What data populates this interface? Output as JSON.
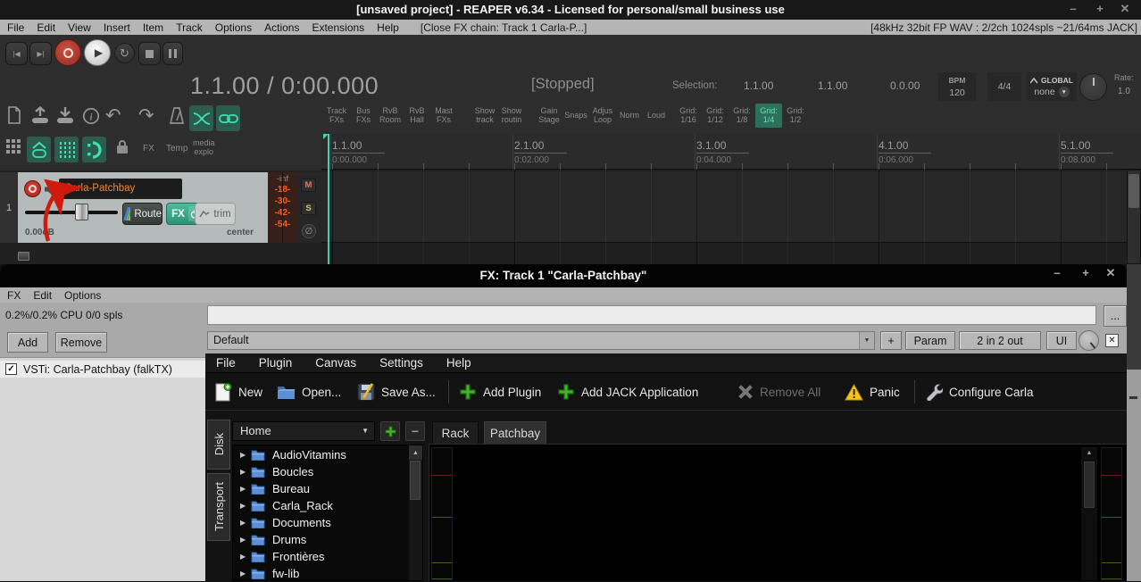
{
  "titlebar": {
    "title": "[unsaved project] - REAPER v6.34 - Licensed for personal/small business use",
    "minimize": "–",
    "maximize": "+",
    "close": "✕"
  },
  "menubar": {
    "items": [
      "File",
      "Edit",
      "View",
      "Insert",
      "Item",
      "Track",
      "Options",
      "Actions",
      "Extensions",
      "Help"
    ],
    "action_hint": "[Close FX chain: Track 1 Carla-P...]",
    "audio_status": "[48kHz 32bit FP WAV : 2/2ch 1024spls ~21/64ms JACK]"
  },
  "transport": {
    "time": "1.1.00 / 0:00.000",
    "status": "[Stopped]",
    "selection_label": "Selection:",
    "selection_start": "1.1.00",
    "selection_end": "1.1.00",
    "selection_length": "0.0.00",
    "bpm_label": "BPM",
    "bpm": "120",
    "time_signature": "4/4",
    "global_label": "GLOBAL",
    "global_value": "none",
    "rate_label": "Rate:",
    "rate": "1.0"
  },
  "toolbar_toggles": {
    "items": [
      {
        "l1": "Track",
        "l2": "FXs"
      },
      {
        "l1": "Bus",
        "l2": "FXs"
      },
      {
        "l1": "RvB",
        "l2": "Room"
      },
      {
        "l1": "RvB",
        "l2": "Hall"
      },
      {
        "l1": "Mast",
        "l2": "FXs"
      },
      {
        "l1": "Show",
        "l2": "track"
      },
      {
        "l1": "Show",
        "l2": "routin"
      },
      {
        "l1": "Gain",
        "l2": "Stage"
      },
      {
        "l1": "Snaps",
        "l2": ""
      },
      {
        "l1": "Adjus",
        "l2": "Loop"
      },
      {
        "l1": "Norm",
        "l2": ""
      },
      {
        "l1": "Loud",
        "l2": ""
      },
      {
        "l1": "Grid:",
        "l2": "1/16"
      },
      {
        "l1": "Grid:",
        "l2": "1/12"
      },
      {
        "l1": "Grid:",
        "l2": "1/8"
      },
      {
        "l1": "Grid:",
        "l2": "1/4"
      },
      {
        "l1": "Grid:",
        "l2": "1/2"
      }
    ]
  },
  "icon_labels": {
    "fx": "FX",
    "temp": "Temp",
    "media_1": "media",
    "media_2": "explo"
  },
  "track": {
    "number": "1",
    "name": "Carla-Patchbay",
    "volume": "0.00dB",
    "pan": "center",
    "route": "Route",
    "fx": "FX",
    "trim": "trim",
    "meter_top": "-inf",
    "marks": [
      "-18-",
      "-30-",
      "-42-",
      "-54-"
    ],
    "mute": "M",
    "solo": "S",
    "phase": "∅"
  },
  "ruler": {
    "majors": [
      {
        "m": "1.1.00",
        "t": "0:00.000"
      },
      {
        "m": "2.1.00",
        "t": "0:02.000"
      },
      {
        "m": "3.1.00",
        "t": "0:04.000"
      },
      {
        "m": "4.1.00",
        "t": "0:06.000"
      },
      {
        "m": "5.1.00",
        "t": "0:08.000"
      }
    ]
  },
  "fx_window": {
    "title": "FX: Track 1 \"Carla-Patchbay\"",
    "minimize": "–",
    "maximize": "+",
    "close": "✕",
    "menu": [
      "FX",
      "Edit",
      "Options"
    ],
    "cpu": "0.2%/0.2% CPU 0/0 spls",
    "more": "...",
    "preset": "Default",
    "add_param": "+",
    "param": "Param",
    "io": "2 in 2 out",
    "ui": "UI",
    "add": "Add",
    "remove": "Remove",
    "chain_item": "VSTi: Carla-Patchbay (falkTX)"
  },
  "carla": {
    "menu": [
      "File",
      "Plugin",
      "Canvas",
      "Settings",
      "Help"
    ],
    "toolbar": {
      "new": "New",
      "open": "Open...",
      "save_as": "Save As...",
      "add_plugin": "Add Plugin",
      "add_jack": "Add JACK Application",
      "remove_all": "Remove All",
      "panic": "Panic",
      "configure": "Configure Carla"
    },
    "side_tabs": [
      "Disk",
      "Transport"
    ],
    "location": "Home",
    "tabs": [
      "Rack",
      "Patchbay"
    ],
    "tree": [
      "AudioVitamins",
      "Boucles",
      "Bureau",
      "Carla_Rack",
      "Documents",
      "Drums",
      "Frontières",
      "fw-lib"
    ]
  },
  "icons": {
    "dropdown": "▼",
    "scroll_up": "▲",
    "check": "✓",
    "expand": "▶",
    "prev": "|◀",
    "next": "▶|",
    "play": "▶",
    "loop": "↻",
    "undo": "↶",
    "redo": "↷",
    "bypass": "✕",
    "minus": "−"
  },
  "colors": {
    "accent_teal": "#3fd9a9",
    "grid_active_green": "#63e7b0",
    "track_name_orange": "#ee8a3c",
    "meter_orange": "#ff5e1c",
    "record_red": "#c0392b",
    "carla_green": "#43b524",
    "panic_yellow": "#f6c51a",
    "folder_blue": "#5d8fd6"
  }
}
